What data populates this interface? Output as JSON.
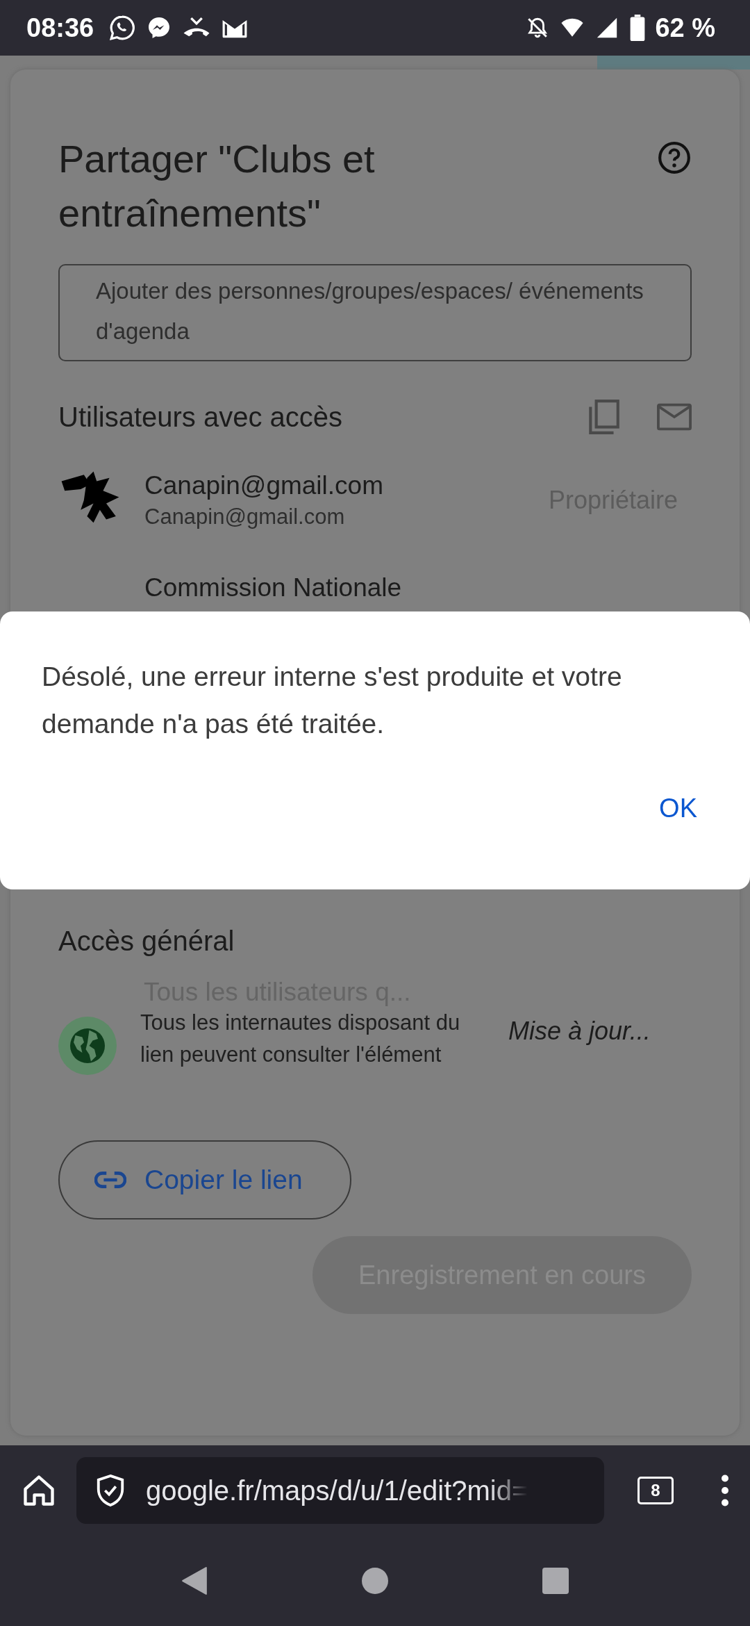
{
  "status_bar": {
    "time": "08:36",
    "battery": "62 %"
  },
  "share_dialog": {
    "title": "Partager \"Clubs et entraînements\"",
    "add_field": {
      "placeholder": "Ajouter des personnes/groupes/espaces/ événements d'agenda"
    },
    "users_heading": "Utilisateurs avec accès",
    "users": [
      {
        "name": "Canapin@gmail.com",
        "email": "Canapin@gmail.com",
        "role": "Propriétaire"
      },
      {
        "name": "Commission Nationale"
      }
    ],
    "general_access": {
      "heading": "Accès général",
      "scope": "Tous les utilisateurs q...",
      "description": "Tous les internautes disposant du lien peuvent consulter l'élément",
      "role": "Mise à jour..."
    },
    "copy_link": "Copier le lien",
    "save_button": {
      "label": "Enregistrement en cours",
      "disabled": true
    }
  },
  "alert": {
    "message": "Désolé, une erreur interne s'est produite et votre demande n'a pas été traitée.",
    "ok": "OK"
  },
  "browser": {
    "url": "google.fr/maps/d/u/1/edit?mid=",
    "tab_count": "8"
  }
}
